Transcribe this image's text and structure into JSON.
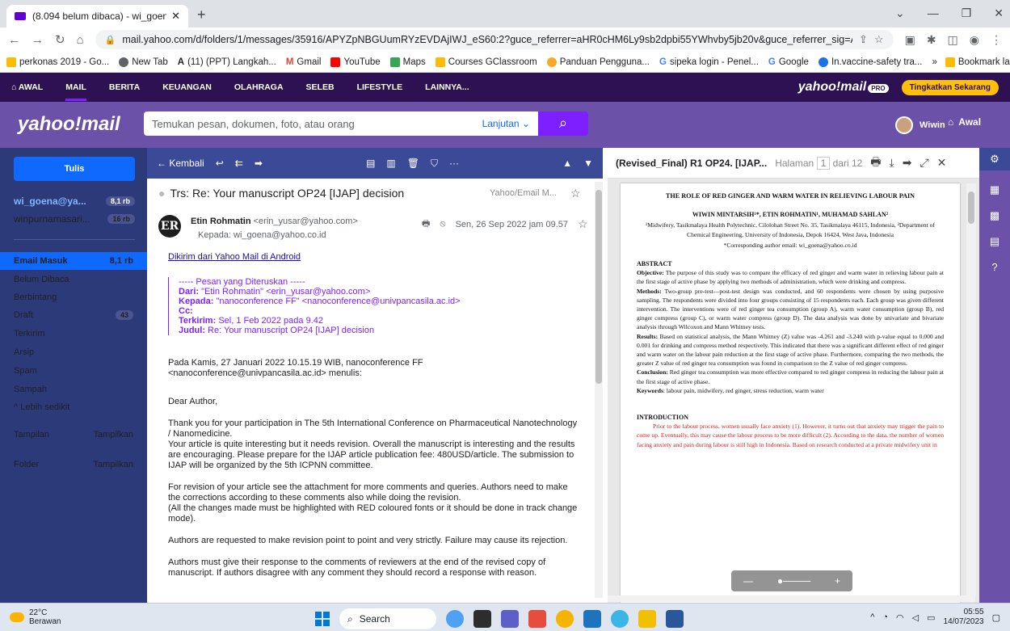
{
  "browser": {
    "tab_title": "(8.094 belum dibaca) - wi_goena",
    "url": "mail.yahoo.com/d/folders/1/messages/35916/APYZpNBGUumRYzEVDAjIWJ_eS60:2?guce_referrer=aHR0cHM6Ly9sb2dpbi55YWhvby5jb20v&guce_referrer_sig=AQAAAHkNgA_oEjW...",
    "bookmarks": [
      "perkonas 2019 - Go...",
      "New Tab",
      "(11) (PPT) Langkah...",
      "Gmail",
      "YouTube",
      "Maps",
      "Courses GClassroom",
      "Panduan Pengguna...",
      "sipeka login - Penel...",
      "Google",
      "In.vaccine-safety tra..."
    ],
    "bookmarks_other": "Bookmark lain"
  },
  "ynav": {
    "items": [
      "AWAL",
      "MAIL",
      "BERITA",
      "KEUANGAN",
      "OLAHRAGA",
      "SELEB",
      "LIFESTYLE",
      "LAINNYA..."
    ],
    "brand": "yahoo!mail",
    "pro": "PRO",
    "upgrade": "Tingkatkan Sekarang"
  },
  "header": {
    "logo": "yahoo!mail",
    "search_placeholder": "Temukan pesan, dokumen, foto, atau orang",
    "advanced": "Lanjutan ⌄",
    "user": "Wiwin",
    "home": "Awal"
  },
  "sidebar": {
    "compose": "Tulis",
    "accounts": [
      {
        "name": "wi_goena@ya...",
        "count": "8,1 rb"
      },
      {
        "name": "winpurnamasari...",
        "count": "16 rb"
      }
    ],
    "folders": [
      {
        "label": "Email Masuk",
        "count": "8,1 rb"
      },
      {
        "label": "Belum Dibaca",
        "count": ""
      },
      {
        "label": "Berbintang",
        "count": ""
      },
      {
        "label": "Draft",
        "count": "43"
      },
      {
        "label": "Terkirim",
        "count": ""
      },
      {
        "label": "Arsip",
        "count": ""
      },
      {
        "label": "Spam",
        "count": ""
      },
      {
        "label": "Sampah",
        "count": ""
      },
      {
        "label": "^ Lebih sedikit",
        "count": ""
      }
    ],
    "views": {
      "label": "Tampilan",
      "action": "Tampilkan"
    },
    "folder": {
      "label": "Folder",
      "action": "Tampilkan"
    }
  },
  "message": {
    "back": "← Kembali",
    "subject": "Trs: Re: Your manuscript OP24 [IJAP] decision",
    "source": "Yahoo/Email M...",
    "avatar_initials": "ER",
    "sender_name": "Etin Rohmatin",
    "sender_email": "<erin_yusar@yahoo.com>",
    "recipient": "Kepada: wi_goena@yahoo.co.id",
    "date": "Sen, 26 Sep 2022 jam 09.57",
    "android_link": "Dikirim dari Yahoo Mail di Android",
    "fwd_header": "----- Pesan yang Diteruskan -----",
    "fwd_from_label": "Dari:",
    "fwd_from": " \"Etin Rohmatin\" <erin_yusar@yahoo.com>",
    "fwd_to_label": "Kepada:",
    "fwd_to": " \"nanoconference FF\" <nanoconference@univpancasila.ac.id>",
    "fwd_cc_label": "Cc:",
    "fwd_sent_label": "Terkirim:",
    "fwd_sent": " Sel, 1 Feb 2022 pada 9.42",
    "fwd_subject_label": "Judul:",
    "fwd_subject": " Re: Your manuscript OP24 [IJAP] decision",
    "quote_header": "Pada Kamis, 27 Januari 2022 10.15.19 WIB, nanoconference FF <nanoconference@univpancasila.ac.id> menulis:",
    "greeting": "Dear Author,",
    "p1": "Thank you for your participation in The 5th International Conference on Pharmaceutical Nanotechnology / Nanomedicine.\nYour article is quite interesting but it needs revision. Overall the manuscript is interesting and the results are encouraging. Please prepare for the IJAP article publication fee: 480USD/article. The submission to IJAP will be organized by the 5th ICPNN committee.",
    "p2": "For revision of your article see the attachment for more comments and queries. Authors need to make the corrections according to these comments also while doing the revision.\n(All the changes made must be highlighted with RED coloured fonts or it should be done in track change mode).",
    "p3": "Authors are requested to make revision point to point and very strictly. Failure may cause its rejection.",
    "p4": "Authors must give their response to the comments of reviewers at the end of the revised copy of manuscript. If authors disagree with any comment they should record a response with reason."
  },
  "pdf": {
    "title": "(Revised_Final) R1 OP24. [IJAP...",
    "page_label": "Halaman",
    "page": "1",
    "of": "dari 12",
    "doc_title": "THE ROLE OF RED GINGER AND WARM WATER IN RELIEVING LABOUR PAIN",
    "authors": "WIWIN MINTARSIH¹*, ETIN ROHMATIN¹, MUHAMAD SAHLAN²",
    "affiliation": "¹Midwifery, Tasikmalaya Health Polytechnic, Cilolohan Street No. 35, Tasikmalaya 46115, Indonesia, ²Department of Chemical Engineering, University of Indonesia, Depok 16424, West Java, Indonesia",
    "corresponding": "*Corresponding author email: wi_goena@yahoo.co.id",
    "abstract_h": "ABSTRACT",
    "objective_l": "Objective:",
    "objective": " The purpose of this study was to compare the efficacy of red ginger and warm water in relieving labour pain at the first stage of active phase by applying two methods of administration, which were drinking and compress.",
    "methods_l": "Methods:",
    "methods": " Two-group pre-test—post-test design was conducted, and 60 respondents were chosen by using purposive sampling. The respondents were divided into four groups consisting of 15 respondents each. Each group was given different intervention. The interventions were of red ginger tea consumption (group A), warm water consumption (group B), red ginger compress (group C), or warm water compress (group D). The data analysis was done by univariate and bivariate analysis through Wilcoxon and Mann Whitney tests.",
    "results_l": "Results:",
    "results": " Based on statistical analysis, the Mann Whitney (Z) value was -4.261 and -3.240 with p-value equal to 0.000 and 0.001 for drinking and compress method respectively. This indicated that there was a significant different effect of red ginger and warm water on the labour pain reduction at the first stage of active phase. Furthermore, comparing the two methods, the greater Z value of red ginger tea consumption was found in comparison to the Z value of red ginger compress.",
    "conclusion_l": "Conclusion:",
    "conclusion": " Red ginger tea consumption was more effective compared to red ginger compress in reducing the labour pain at the first stage of active phase.",
    "keywords_l": "Keywords",
    "keywords": ": labour pain, midwifery, red ginger, stress reduction, warm water",
    "intro_h": "INTRODUCTION",
    "intro": "Prior to the labour process, women usually face anxiety (1). However, it turns out that anxiety may trigger the pain to come up. Eventually, this may cause the labour process to be more difficult (2). According to the data, the number of women facing anxiety and pain during labour is still high in Indonesia. Based on research conducted at a private midwifery unit in"
  },
  "taskbar": {
    "temp": "22°C",
    "weather": "Berawan",
    "search": "Search",
    "time": "05:55",
    "date": "14/07/2023"
  }
}
